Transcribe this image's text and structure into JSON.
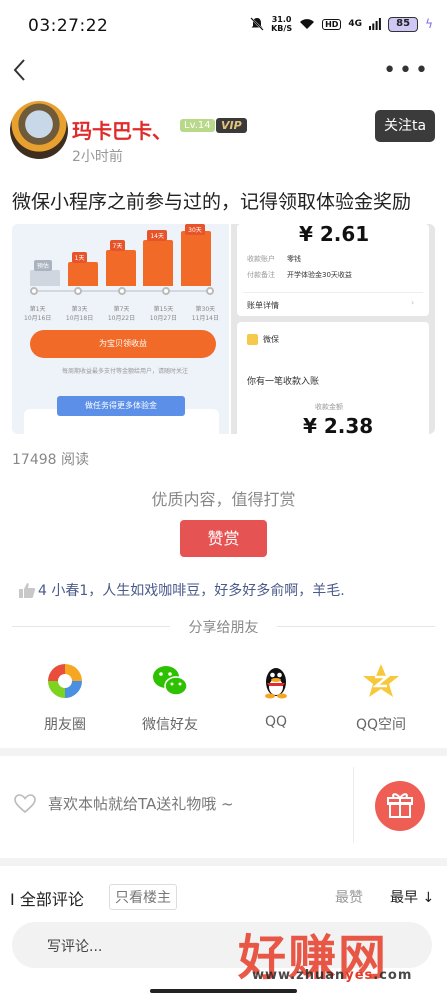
{
  "status_bar": {
    "time": "03:27:22",
    "net_speed_value": "31.0",
    "net_speed_unit": "KB/S",
    "hd": "HD",
    "signal": "4G",
    "battery": "85"
  },
  "author": {
    "name": "玛卡巴卡、",
    "level": "Lv.14",
    "vip": "VIP",
    "time": "2小时前",
    "follow_label": "关注ta"
  },
  "post": {
    "title": "微保小程序之前参与过的，记得领取体验金奖励",
    "read_count": "17498 阅读"
  },
  "image_left": {
    "bars": [
      {
        "label": "预估",
        "value": 0.28
      },
      {
        "label": "1天",
        "value": 0.42
      },
      {
        "label": "7天",
        "value": 0.62
      },
      {
        "label": "14天",
        "value": 0.8
      },
      {
        "label": "30天",
        "value": 0.95
      }
    ],
    "days": [
      "第1天",
      "第3天",
      "第7天",
      "第15天",
      "第30天"
    ],
    "dates": [
      "10月16日",
      "10月18日",
      "10月22日",
      "10月27日",
      "11月14日"
    ],
    "pill_label": "为宝贝领收益",
    "note": "每周期收益最多支付等金额给用户，请随时关注",
    "banner_label": "做任务得更多体验金"
  },
  "image_right": {
    "amount_top": "¥ 2.61",
    "row1_label": "收款账户",
    "row1_value": "零钱",
    "row2_label": "付款备注",
    "row2_value": "开学体验金30天收益",
    "bill_label": "账单详情",
    "app_name": "微保",
    "received_text": "你有一笔收款入账",
    "amount_label": "收款金额",
    "amount_bottom": "¥ 2.38"
  },
  "tip": {
    "text": "优质内容，值得打赏",
    "button_label": "赞赏"
  },
  "likes": {
    "text": "4 小春1，人生如戏咖啡豆，好多好多俞啊，羊毛."
  },
  "share": {
    "title": "分享给朋友",
    "items": [
      {
        "label": "朋友圈",
        "icon": "moments-icon"
      },
      {
        "label": "微信好友",
        "icon": "wechat-icon"
      },
      {
        "label": "QQ",
        "icon": "qq-icon"
      },
      {
        "label": "QQ空间",
        "icon": "qzone-icon"
      }
    ]
  },
  "gift": {
    "text": "喜欢本帖就给TA送礼物哦 ~"
  },
  "comments": {
    "title": "全部评论",
    "owner_only": "只看楼主",
    "sort_hot": "最赞",
    "sort_new": "最早"
  },
  "comment_input": {
    "placeholder": "写评论..."
  },
  "watermark": {
    "text": "好赚网",
    "url_pre": "www.zhuan",
    "url_mid": "yes",
    "url_post": ".com"
  }
}
